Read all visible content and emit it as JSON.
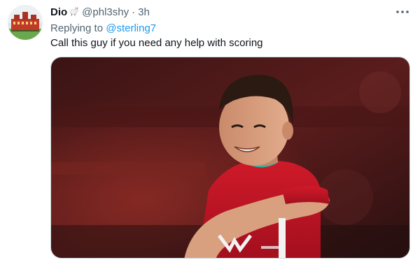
{
  "tweet": {
    "display_name": "Dio",
    "name_emoji_icon": "goat-icon",
    "handle": "@phl3shy",
    "separator": "·",
    "time": "3h",
    "more_icon": "more-horizontal-icon",
    "replying_to_label": "Replying to ",
    "replying_to_handle": "@sterling7",
    "text": "Call this guy if you need any help with scoring",
    "media_description_icon": "photo-icon"
  },
  "colors": {
    "primary_text": "#0f1419",
    "secondary_text": "#536471",
    "link": "#1d9bf0",
    "jersey_red": "#c8102e"
  }
}
